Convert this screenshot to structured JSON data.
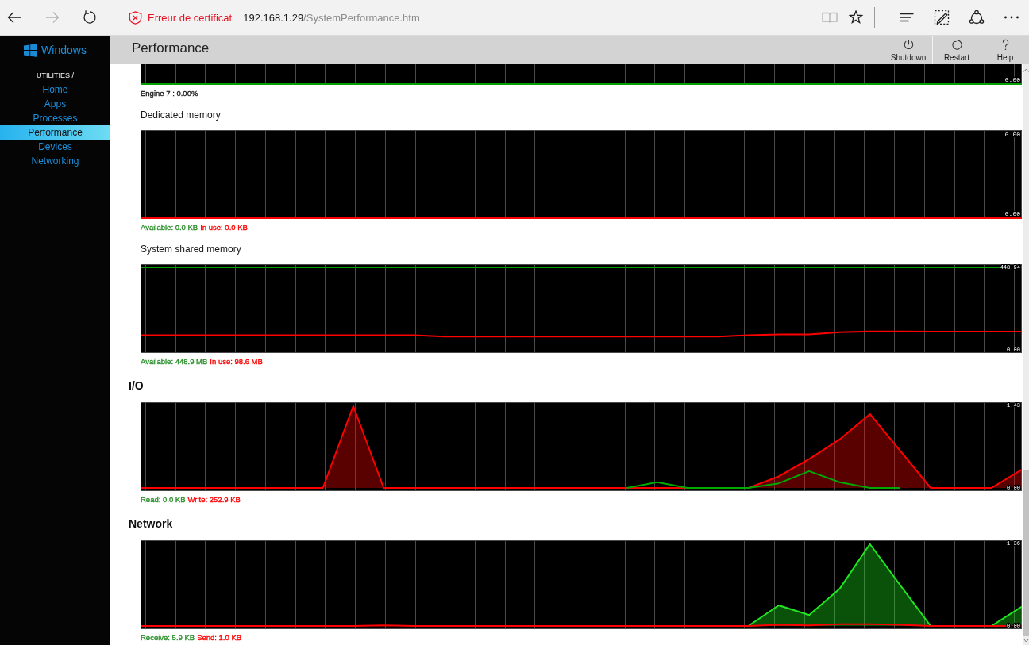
{
  "browser": {
    "nav": [
      {
        "kind": "back",
        "disabled": false
      },
      {
        "kind": "forward",
        "disabled": true
      },
      {
        "kind": "refresh",
        "disabled": false
      }
    ],
    "certificate_warning": "Erreur de certificat",
    "url": {
      "host": "192.168.1.29",
      "path": "/SystemPerformance.htm"
    },
    "tool_groups": [
      [
        {
          "kind": "reading",
          "disabled": true
        },
        {
          "kind": "favorite",
          "disabled": false
        }
      ],
      [
        {
          "kind": "hub",
          "disabled": false
        },
        {
          "kind": "note",
          "disabled": false
        },
        {
          "kind": "share",
          "disabled": false
        },
        {
          "kind": "more",
          "disabled": false
        }
      ]
    ]
  },
  "sidebar": {
    "logo": "Windows",
    "section": "UTILITIES /",
    "items": [
      {
        "label": "Home",
        "selected": false
      },
      {
        "label": "Apps",
        "selected": false
      },
      {
        "label": "Processes",
        "selected": false
      },
      {
        "label": "Performance",
        "selected": true
      },
      {
        "label": "Devices",
        "selected": false
      },
      {
        "label": "Networking",
        "selected": false
      }
    ]
  },
  "header": {
    "title": "Performance",
    "buttons": [
      {
        "kind": "power",
        "label": "Shutdown"
      },
      {
        "kind": "restart",
        "label": "Restart"
      },
      {
        "kind": "help",
        "label": "Help"
      }
    ]
  },
  "content": [
    {
      "kind": "cutoff",
      "picture": {
        "bottom_label": "0.00",
        "lines": [
          {
            "color": "#00a000"
          }
        ]
      },
      "legend": [
        {
          "text": "Engine 7 : 0.00%",
          "color": "#1a1a1a"
        }
      ]
    },
    {
      "kind": "graph",
      "title": "Dedicated memory",
      "picture": {
        "top_label": "0.00",
        "bottom_label": "0.00",
        "lines": [
          {
            "color": "#ff0000"
          }
        ]
      },
      "legend": [
        {
          "text": "Available: 0.0 KB",
          "color": "#2a8f2a"
        },
        {
          "text": "In use: 0.0 KB",
          "color": "#ff0000"
        }
      ]
    },
    {
      "kind": "graph",
      "title": "System shared memory",
      "chart_data": {
        "type": "line",
        "grid": true,
        "ylim": [
          -17.27,
          466.21
        ],
        "yticks": [
          {
            "value": 0,
            "label": "0.00"
          },
          {
            "value": 448.94,
            "label": "448.94"
          }
        ],
        "series": [
          {
            "color": "#00a000",
            "values": [
              449,
              449,
              449,
              449,
              449,
              449,
              449,
              449,
              449,
              449,
              449,
              449,
              449,
              449,
              449,
              449,
              449,
              449,
              449,
              449,
              449,
              449,
              449,
              449,
              449,
              449,
              449,
              449,
              449,
              449
            ]
          },
          {
            "color": "#ff0000",
            "values": [
              80,
              80,
              80,
              80,
              80,
              80,
              80,
              80,
              80,
              80,
              72,
              72,
              72,
              72,
              72,
              72,
              72,
              72,
              72,
              72,
              80,
              84,
              84,
              96,
              100,
              100,
              99,
              99,
              99,
              99
            ]
          }
        ]
      },
      "legend": [
        {
          "text": "Available: 448.9 MB",
          "color": "#2a8f2a"
        },
        {
          "text": "In use: 98.6 MB",
          "color": "#ff0000"
        }
      ]
    },
    {
      "kind": "heading",
      "text": "I/O"
    },
    {
      "kind": "graph",
      "chart_data": {
        "type": "area",
        "grid": true,
        "ylim": [
          -0.055,
          1.485
        ],
        "yticks": [
          {
            "value": 0,
            "label": "0.00"
          },
          {
            "value": 1.43,
            "label": "1.43"
          }
        ],
        "series": [
          {
            "color": "#ff0000",
            "values": [
              0,
              0,
              0,
              0,
              0,
              0,
              0,
              1.42,
              0,
              0,
              0,
              0,
              0,
              0,
              0,
              0,
              0,
              0,
              0,
              0,
              0,
              0.2,
              0.5,
              0.84,
              1.28,
              0.64,
              0,
              0,
              0,
              0.32
            ]
          },
          {
            "type": "line",
            "color": "#00a800",
            "values": [
              null,
              null,
              null,
              null,
              null,
              null,
              null,
              null,
              null,
              null,
              null,
              null,
              null,
              null,
              null,
              null,
              0,
              0.1,
              0,
              0,
              0,
              0.08,
              0.29,
              0.1,
              0,
              0,
              null,
              null,
              null,
              null
            ]
          }
        ]
      },
      "legend": [
        {
          "text": "Read: 0.0 KB",
          "color": "#2a8f2a"
        },
        {
          "text": "Write: 252.9 KB",
          "color": "#ff0000"
        }
      ]
    },
    {
      "kind": "heading",
      "text": "Network"
    },
    {
      "kind": "graph",
      "chart_data": {
        "type": "area",
        "grid": true,
        "ylim": [
          -0.0523,
          1.4123
        ],
        "yticks": [
          {
            "value": 0,
            "label": "0.00"
          },
          {
            "value": 1.36,
            "label": "1.36"
          }
        ],
        "series": [
          {
            "color": "#1ee81e",
            "values": [
              null,
              null,
              null,
              null,
              null,
              null,
              null,
              null,
              null,
              null,
              null,
              null,
              null,
              null,
              null,
              null,
              null,
              null,
              null,
              null,
              0,
              0.34,
              0.18,
              0.61,
              1.35,
              0.67,
              0,
              0,
              0,
              0.32
            ]
          },
          {
            "type": "line",
            "color": "#ff0000",
            "values": [
              0,
              0,
              0,
              0,
              0,
              0,
              0,
              0,
              0.01,
              0,
              0,
              0,
              0,
              0,
              0,
              0,
              0,
              0,
              0,
              0,
              0,
              0.02,
              0.01,
              0.03,
              0.03,
              0.02,
              0,
              0,
              0,
              0
            ]
          }
        ]
      },
      "legend": [
        {
          "text": "Receive: 5.9 KB",
          "color": "#2a8f2a"
        },
        {
          "text": "Send: 1.0 KB",
          "color": "#ff0000"
        }
      ]
    }
  ]
}
